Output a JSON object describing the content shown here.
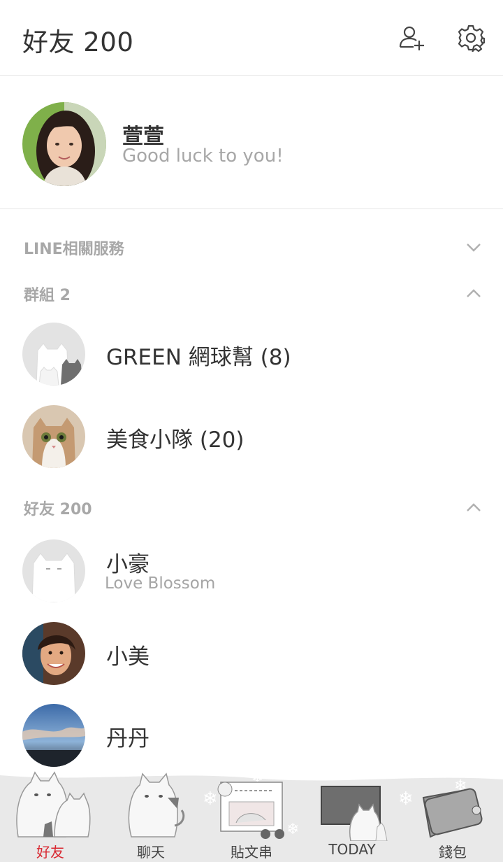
{
  "header": {
    "title": "好友 200",
    "add_friend_icon": "add-friend-icon",
    "settings_icon": "gear-icon"
  },
  "profile": {
    "name": "萱萱",
    "status": "Good luck to you!"
  },
  "sections": {
    "line_services": {
      "label": "LINE相關服務",
      "state": "collapsed"
    },
    "groups": {
      "label": "群組 2",
      "state": "expanded"
    },
    "friends": {
      "label": "好友 200",
      "state": "expanded"
    }
  },
  "groups": [
    {
      "name": "GREEN 網球幫 (8)"
    },
    {
      "name": "美食小隊 (20)"
    }
  ],
  "friends": [
    {
      "name": "小豪",
      "status": "Love Blossom"
    },
    {
      "name": "小美",
      "status": ""
    },
    {
      "name": "丹丹",
      "status": ""
    }
  ],
  "tabs": [
    {
      "label": "好友",
      "active": true
    },
    {
      "label": "聊天",
      "active": false
    },
    {
      "label": "貼文串",
      "active": false
    },
    {
      "label": "TODAY",
      "active": false
    },
    {
      "label": "錢包",
      "active": false
    }
  ],
  "colors": {
    "active_tab": "#d9262f",
    "muted_text": "#a8a8a8",
    "divider": "#e6e6e6"
  }
}
